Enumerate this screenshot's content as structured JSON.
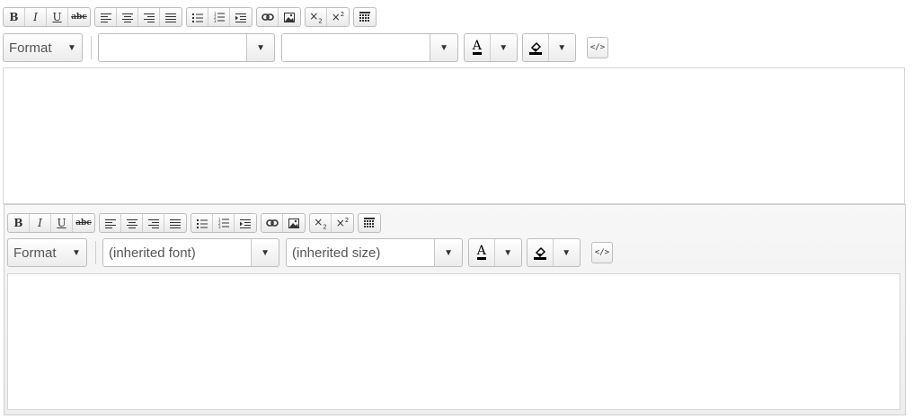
{
  "editors": [
    {
      "format_label": "Format",
      "font_value": "",
      "size_value": "",
      "source_label": "</>"
    },
    {
      "format_label": "Format",
      "font_value": "(inherited font)",
      "size_value": "(inherited size)",
      "source_label": "</>"
    }
  ],
  "toolbar": {
    "bold": "B",
    "italic": "I",
    "underline": "U",
    "strike": "abc",
    "text_color": "A",
    "dropdown_arrow": "▼",
    "icons": [
      "bold-icon",
      "italic-icon",
      "underline-icon",
      "strikethrough-icon",
      "align-left-icon",
      "align-center-icon",
      "align-right-icon",
      "align-justify-icon",
      "bullet-list-icon",
      "numbered-list-icon",
      "indent-icon",
      "link-icon",
      "image-icon",
      "subscript-icon",
      "superscript-icon",
      "table-icon",
      "text-color-icon",
      "background-color-icon",
      "source-code-icon"
    ]
  },
  "colors": {
    "border": "#bdbdbd",
    "toolbar_bg": "#eeeeee",
    "content_bg": "#ffffff"
  }
}
